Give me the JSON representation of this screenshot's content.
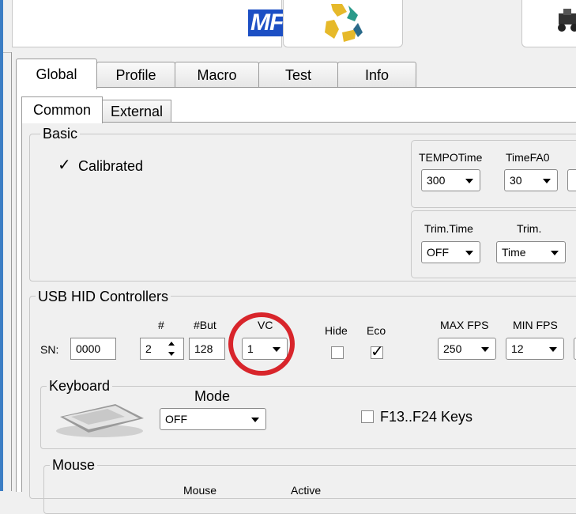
{
  "header": {
    "logo_text": "MF",
    "icons": [
      "recycle-icon",
      "car-icon"
    ]
  },
  "tabs": [
    {
      "label": "Global",
      "active": true
    },
    {
      "label": "Profile",
      "active": false
    },
    {
      "label": "Macro",
      "active": false
    },
    {
      "label": "Test",
      "active": false
    },
    {
      "label": "Info",
      "active": false
    }
  ],
  "subtabs": [
    {
      "label": "Common",
      "active": true
    },
    {
      "label": "External",
      "active": false
    }
  ],
  "basic": {
    "title": "Basic",
    "calibrated_label": "Calibrated",
    "calibrated_checked": true,
    "tempo_time_label": "TEMPOTime",
    "tempo_time_value": "300",
    "time_fa0_label": "TimeFA0",
    "time_fa0_value": "30",
    "trim_time_label": "Trim.Time",
    "trim_time_value": "OFF",
    "trim_label": "Trim.",
    "trim_value": "Time"
  },
  "usb": {
    "title": "USB HID Controllers",
    "sn_label": "SN:",
    "sn_value": "0000",
    "num_label": "#",
    "num_value": "2",
    "but_label": "#But",
    "but_value": "128",
    "vc_label": "VC",
    "vc_value": "1",
    "hide_label": "Hide",
    "eco_label": "Eco",
    "hide_checked": false,
    "eco_checked": true,
    "max_fps_label": "MAX FPS",
    "max_fps_value": "250",
    "min_fps_label": "MIN FPS",
    "min_fps_value": "12"
  },
  "keyboard": {
    "title": "Keyboard",
    "mode_label": "Mode",
    "mode_value": "OFF",
    "fkeys_label": "F13..F24 Keys",
    "fkeys_checked": false
  },
  "mouse": {
    "title": "Mouse",
    "col1_label": "Mouse",
    "col2_label": "Active"
  },
  "colors": {
    "highlight_circle": "#d8252b",
    "logo_blue": "#1c4fc4"
  }
}
